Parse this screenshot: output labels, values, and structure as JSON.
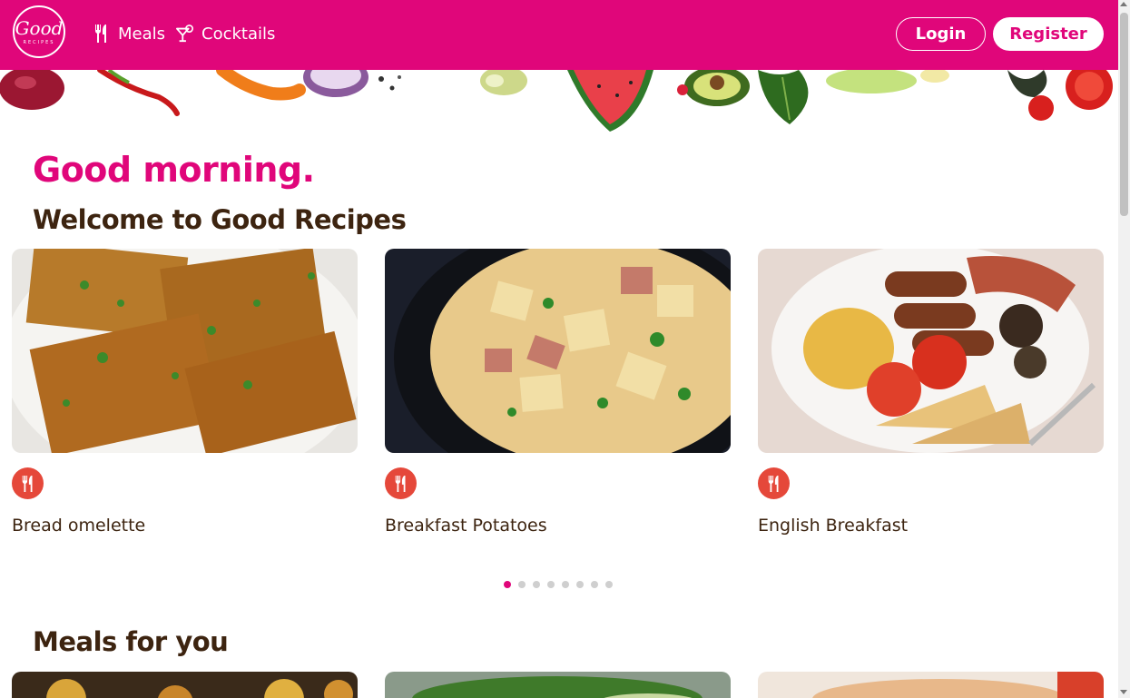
{
  "header": {
    "logo_word": "Good",
    "logo_sub": "RECIPES",
    "nav": [
      {
        "label": "Meals",
        "icon": "fork-knife-icon"
      },
      {
        "label": "Cocktails",
        "icon": "cocktail-icon"
      }
    ],
    "login_label": "Login",
    "register_label": "Register",
    "brand_color": "#e0067a"
  },
  "greeting": "Good morning.",
  "welcome": "Welcome to Good Recipes",
  "carousel": {
    "cards": [
      {
        "title": "Bread omelette",
        "badge_icon": "fork-knife-icon"
      },
      {
        "title": "Breakfast Potatoes",
        "badge_icon": "fork-knife-icon"
      },
      {
        "title": "English Breakfast",
        "badge_icon": "fork-knife-icon"
      }
    ],
    "page_count": 8,
    "active_page": 1,
    "badge_color": "#e5483a"
  },
  "meals_section": {
    "title": "Meals for you"
  }
}
